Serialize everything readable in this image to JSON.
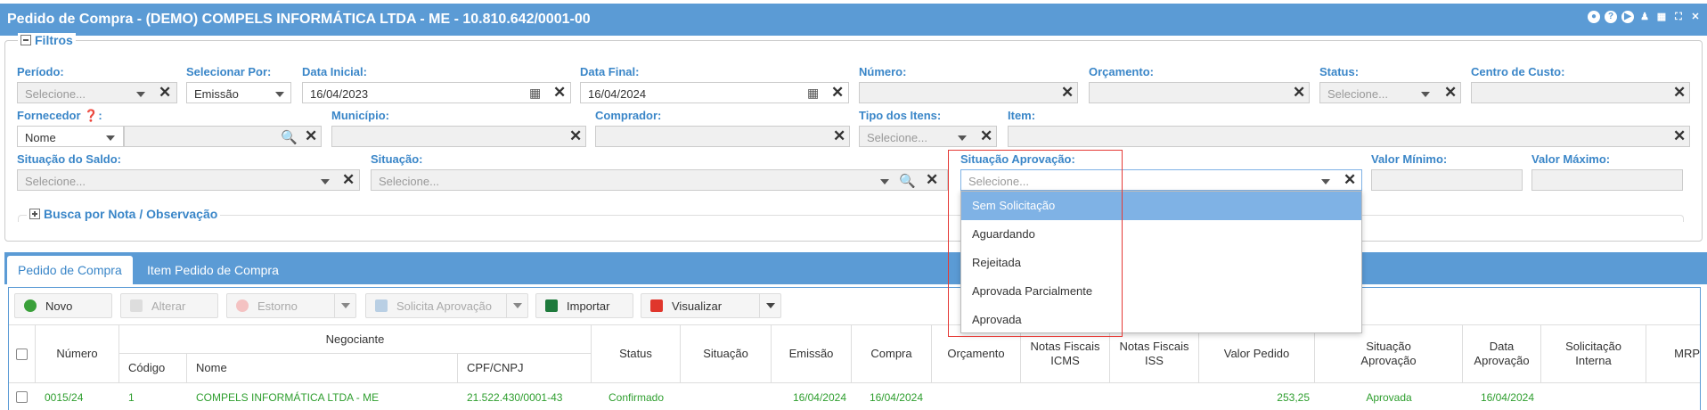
{
  "window": {
    "title": "Pedido de Compra - (DEMO) COMPELS INFORMÁTICA LTDA - ME - 10.810.642/0001-00"
  },
  "filters": {
    "legend": "Filtros",
    "periodo": {
      "label": "Período:",
      "placeholder": "Selecione..."
    },
    "selecionar_por": {
      "label": "Selecionar Por:",
      "value": "Emissão"
    },
    "data_inicial": {
      "label": "Data Inicial:",
      "value": "16/04/2023"
    },
    "data_final": {
      "label": "Data Final:",
      "value": "16/04/2024"
    },
    "numero": {
      "label": "Número:"
    },
    "orcamento": {
      "label": "Orçamento:"
    },
    "status": {
      "label": "Status:",
      "placeholder": "Selecione..."
    },
    "centro_custo": {
      "label": "Centro de Custo:"
    },
    "fornecedor": {
      "label": "Fornecedor",
      "type": "Nome"
    },
    "municipio": {
      "label": "Município:"
    },
    "comprador": {
      "label": "Comprador:"
    },
    "tipo_itens": {
      "label": "Tipo dos Itens:",
      "placeholder": "Selecione..."
    },
    "item": {
      "label": "Item:"
    },
    "situacao_saldo": {
      "label": "Situação do Saldo:",
      "placeholder": "Selecione..."
    },
    "situacao": {
      "label": "Situação:",
      "placeholder": "Selecione..."
    },
    "situacao_aprovacao": {
      "label": "Situação Aprovação:",
      "placeholder": "Selecione..."
    },
    "valor_minimo": {
      "label": "Valor Mínimo:"
    },
    "valor_maximo": {
      "label": "Valor Máximo:"
    },
    "busca_nota": "Busca por Nota / Observação"
  },
  "dropdown_options": [
    "Sem Solicitação",
    "Aguardando",
    "Rejeitada",
    "Aprovada Parcialmente",
    "Aprovada"
  ],
  "tabs": [
    "Pedido de Compra",
    "Item Pedido de Compra"
  ],
  "toolbar": {
    "novo": "Novo",
    "alterar": "Alterar",
    "estorno": "Estorno",
    "solicita_aprovacao": "Solicita Aprovação",
    "importar": "Importar",
    "visualizar": "Visualizar"
  },
  "grid": {
    "headers": {
      "numero": "Número",
      "negociante": "Negociante",
      "codigo": "Código",
      "nome": "Nome",
      "cpf_cnpj": "CPF/CNPJ",
      "status": "Status",
      "situacao": "Situação",
      "emissao": "Emissão",
      "compra": "Compra",
      "orcamento": "Orçamento",
      "nf_icms_1": "Notas Fiscais",
      "nf_icms_2": "ICMS",
      "nf_iss_1": "Notas Fiscais",
      "nf_iss_2": "ISS",
      "valor_pedido": "Valor Pedido",
      "sit_aprov_1": "Situação",
      "sit_aprov_2": "Aprovação",
      "data_aprov_1": "Data",
      "data_aprov_2": "Aprovação",
      "sol_interna_1": "Solicitação",
      "sol_interna_2": "Interna",
      "mrp": "MRP"
    },
    "rows": [
      {
        "numero": "0015/24",
        "codigo": "1",
        "nome": "COMPELS INFORMÁTICA LTDA - ME",
        "cpf_cnpj": "21.522.430/0001-43",
        "status": "Confirmado",
        "emissao": "16/04/2024",
        "compra": "16/04/2024",
        "valor_pedido": "253,25",
        "situacao_aprovacao": "Aprovada",
        "data_aprovacao": "16/04/2024"
      }
    ]
  },
  "colors": {
    "primary": "#5b9bd5",
    "label": "#3a86c8",
    "row_text": "#2e9e2e",
    "highlight": "#e53935"
  }
}
